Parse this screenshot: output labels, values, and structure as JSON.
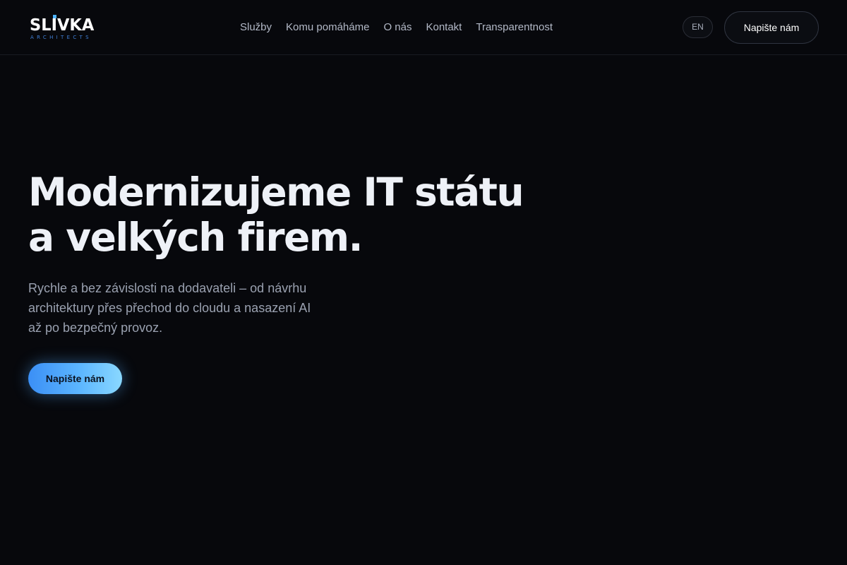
{
  "brand": {
    "logo_text": "SLIVKA",
    "logo_subtext": "ARCHITECTS",
    "accent_color": "#4db3ff"
  },
  "nav": {
    "items": [
      "Služby",
      "Komu pomáháme",
      "O nás",
      "Kontakt",
      "Transparentnost"
    ]
  },
  "header": {
    "language_label": "EN",
    "cta_label": "Napište nám"
  },
  "hero": {
    "title_lines": [
      "Modernizujeme IT státu",
      "a velkých firem."
    ],
    "subtitle_lines": [
      "Rychle a bez závislosti na dodavateli – od návrhu",
      "architektury přes přechod do cloudu a nasazení AI",
      "až po bezpečný provoz."
    ],
    "cta_label": "Napište nám",
    "cta_gradient": [
      "#3b8ff5",
      "#8ad8ff"
    ]
  }
}
